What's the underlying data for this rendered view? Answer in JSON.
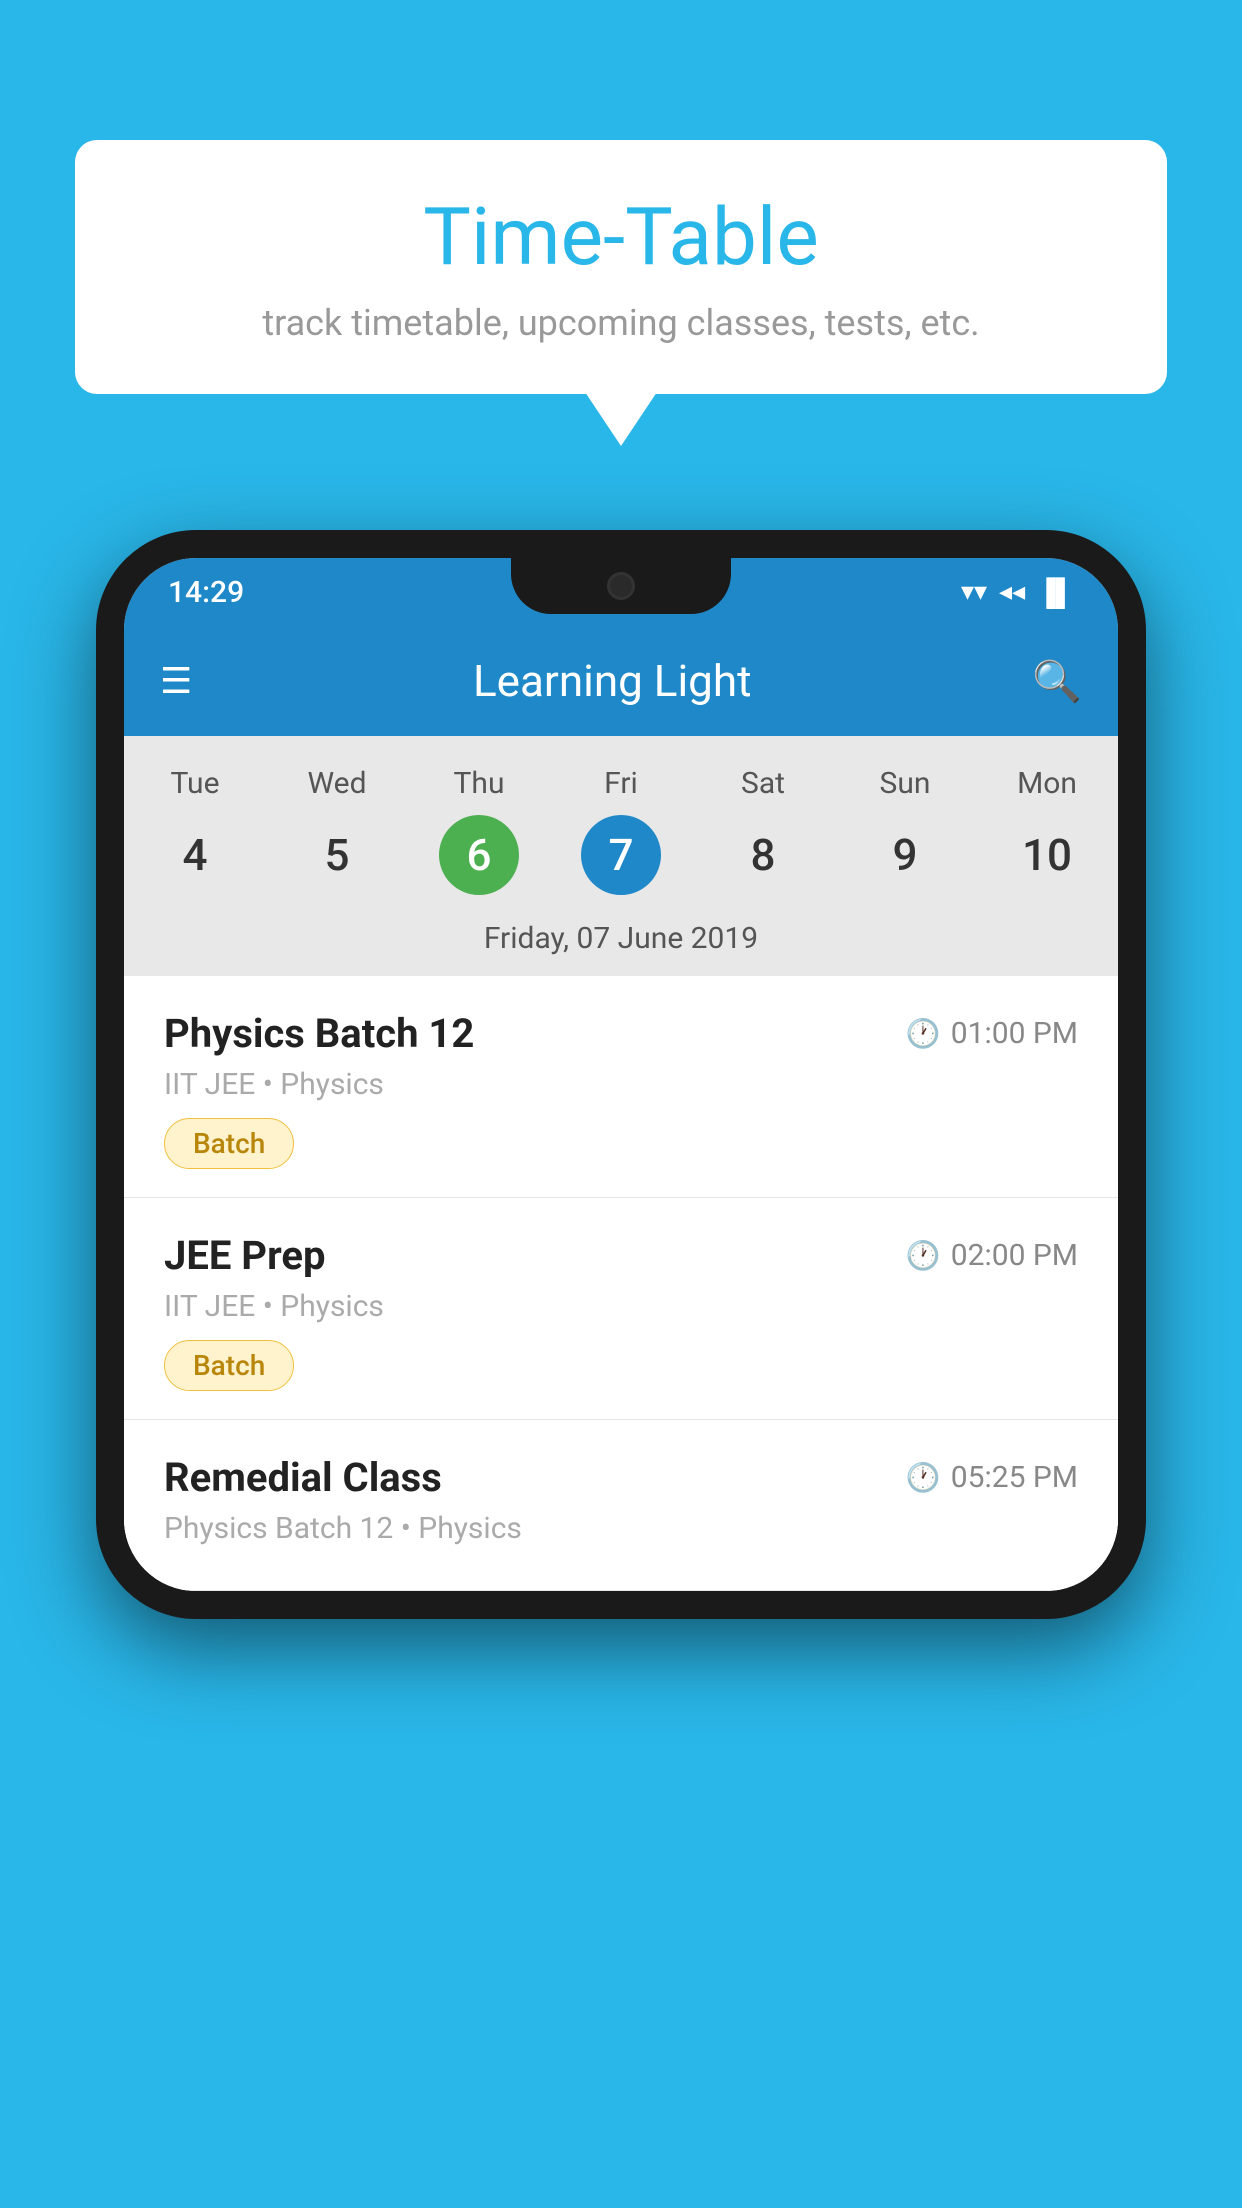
{
  "background_color": "#29B6E8",
  "speech_bubble": {
    "title": "Time-Table",
    "subtitle": "track timetable, upcoming classes, tests, etc."
  },
  "status_bar": {
    "time": "14:29",
    "wifi_icon": "▼",
    "signal_icon": "▲",
    "battery_icon": "▐"
  },
  "app_bar": {
    "title": "Learning Light",
    "hamburger_icon": "☰",
    "search_icon": "🔍"
  },
  "calendar": {
    "days": [
      {
        "label": "Tue",
        "number": "4",
        "state": "normal"
      },
      {
        "label": "Wed",
        "number": "5",
        "state": "normal"
      },
      {
        "label": "Thu",
        "number": "6",
        "state": "today"
      },
      {
        "label": "Fri",
        "number": "7",
        "state": "selected"
      },
      {
        "label": "Sat",
        "number": "8",
        "state": "normal"
      },
      {
        "label": "Sun",
        "number": "9",
        "state": "normal"
      },
      {
        "label": "Mon",
        "number": "10",
        "state": "normal"
      }
    ],
    "selected_date_label": "Friday, 07 June 2019"
  },
  "schedule_items": [
    {
      "title": "Physics Batch 12",
      "time": "01:00 PM",
      "subtitle": "IIT JEE • Physics",
      "badge": "Batch"
    },
    {
      "title": "JEE Prep",
      "time": "02:00 PM",
      "subtitle": "IIT JEE • Physics",
      "badge": "Batch"
    },
    {
      "title": "Remedial Class",
      "time": "05:25 PM",
      "subtitle": "Physics Batch 12 • Physics",
      "badge": null
    }
  ]
}
